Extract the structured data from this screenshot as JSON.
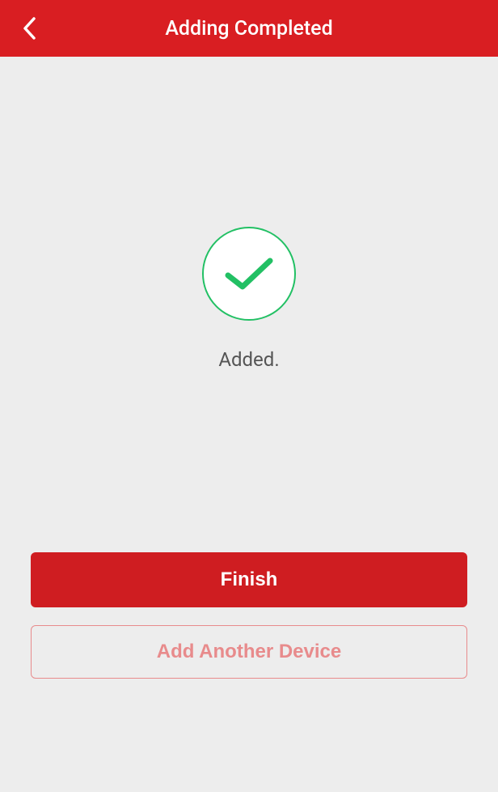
{
  "header": {
    "title": "Adding Completed"
  },
  "main": {
    "status_text": "Added.",
    "finish_label": "Finish",
    "add_another_label": "Add Another Device"
  },
  "colors": {
    "brand_red": "#d91e22",
    "button_red": "#cf1d21",
    "outline_red": "#e88b8c",
    "success_green": "#22c064",
    "bg_gray": "#ededed",
    "text_gray": "#555555"
  }
}
